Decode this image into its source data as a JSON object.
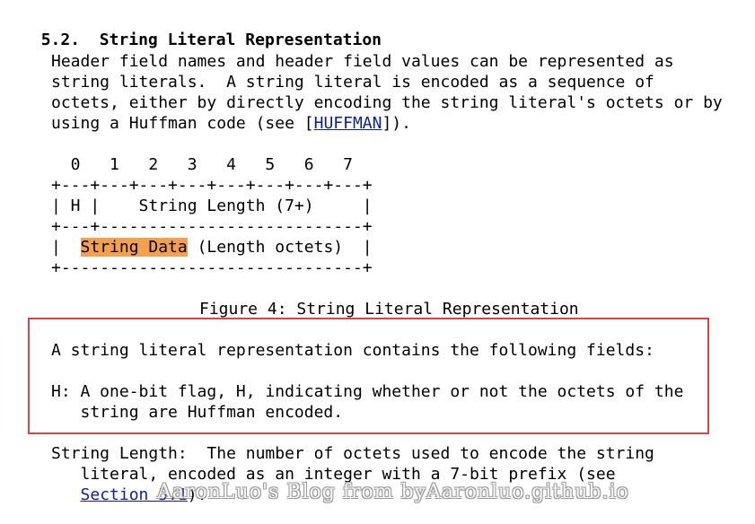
{
  "section": {
    "number": "5.2.",
    "title": "String Literal Representation"
  },
  "intro": {
    "line1": "Header field names and header field values can be represented as",
    "line2": "string literals.  A string literal is encoded as a sequence of",
    "line3": "octets, either by directly encoding the string literal's octets or by",
    "line4_prefix": "using a Huffman code (see [",
    "line4_link": "HUFFMAN",
    "line4_suffix": "])."
  },
  "diagram": {
    "bits": "  0   1   2   3   4   5   6   7",
    "border_top": "+---+---+---+---+---+---+---+---+",
    "row1": "| H |    String Length (7+)     |",
    "border_mid": "+---+---------------------------+",
    "row2_prefix": "|  ",
    "row2_highlight": "String Data",
    "row2_suffix": " (Length octets)  |",
    "border_bottom": "+-------------------------------+"
  },
  "figure_caption": "Figure 4: String Literal Representation",
  "fields": {
    "summary": "A string literal representation contains the following fields:",
    "h_line1": "H: A one-bit flag, H, indicating whether or not the octets of the",
    "h_line2": "   string are Huffman encoded.",
    "len_line1": "String Length:  The number of octets used to encode the string",
    "len_line2": "   literal, encoded as an integer with a 7-bit prefix (see",
    "len_line3_prefix": "   ",
    "len_line3_link": "Section 5.1",
    "len_line3_suffix": ")."
  },
  "watermark": "AaronLuo's Blog from byAaronluo.github.io",
  "colors": {
    "link": "#0b1ea8",
    "highlight": "#f4a14d",
    "box_border": "#d9434a"
  }
}
